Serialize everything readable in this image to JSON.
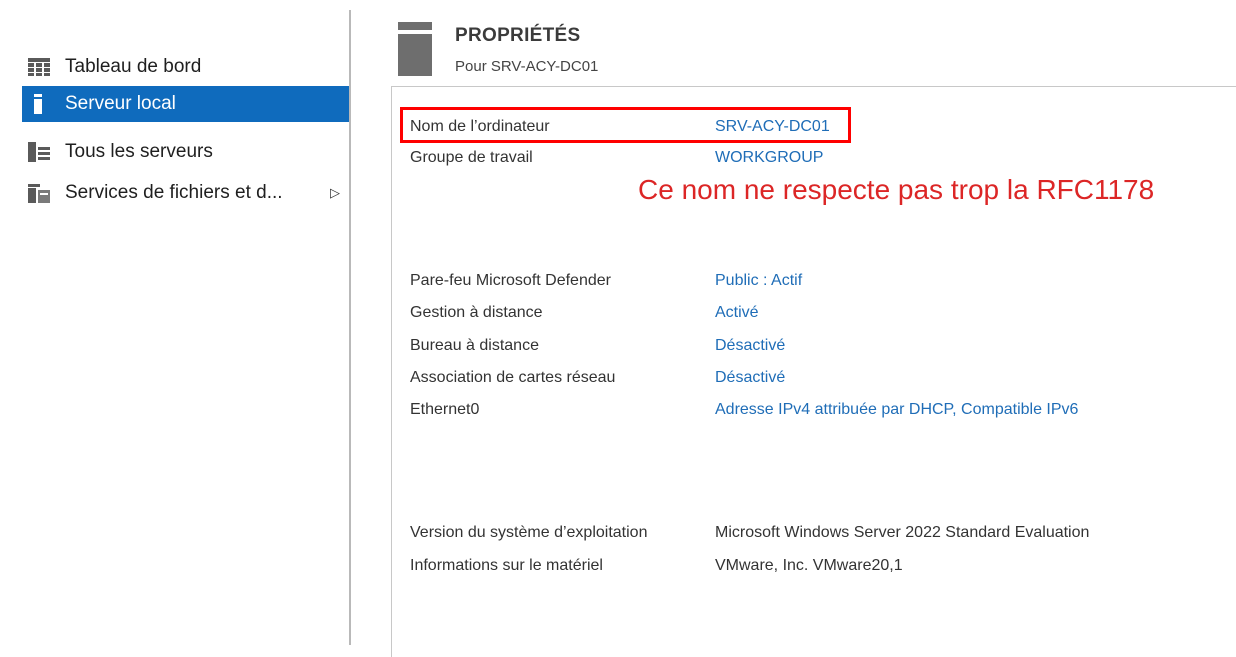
{
  "sidebar": {
    "items": [
      {
        "label": "Tableau de bord",
        "icon": "dashboard-icon",
        "active": false
      },
      {
        "label": "Serveur local",
        "icon": "local-server-icon",
        "active": true
      },
      {
        "label": "Tous les serveurs",
        "icon": "all-servers-icon",
        "active": false
      },
      {
        "label": "Services de fichiers et d...",
        "icon": "file-services-icon",
        "active": false,
        "has_submenu": true
      }
    ],
    "active_color": "#0f6bbd"
  },
  "header": {
    "title": "PROPRIÉTÉS",
    "subtitle": "Pour SRV-ACY-DC01"
  },
  "properties": {
    "group1": [
      {
        "label": "Nom de l’ordinateur",
        "value": "SRV-ACY-DC01"
      },
      {
        "label": "Groupe de travail",
        "value": "WORKGROUP"
      }
    ],
    "group2": [
      {
        "label": "Pare-feu Microsoft Defender",
        "value": "Public : Actif"
      },
      {
        "label": "Gestion à distance",
        "value": "Activé"
      },
      {
        "label": "Bureau à distance",
        "value": "Désactivé"
      },
      {
        "label": "Association de cartes réseau",
        "value": "Désactivé"
      },
      {
        "label": "Ethernet0",
        "value": "Adresse IPv4 attribuée par DHCP, Compatible IPv6"
      }
    ],
    "group3": [
      {
        "label": "Version du système d’exploitation",
        "value": "Microsoft Windows Server 2022 Standard Evaluation"
      },
      {
        "label": "Informations sur le matériel",
        "value": "VMware, Inc. VMware20,1"
      }
    ]
  },
  "annotation": {
    "text": "Ce nom ne respecte pas trop la RFC1178",
    "color": "#dc2626"
  },
  "colors": {
    "link": "#1f6db7",
    "highlight_border": "#ff0000"
  }
}
